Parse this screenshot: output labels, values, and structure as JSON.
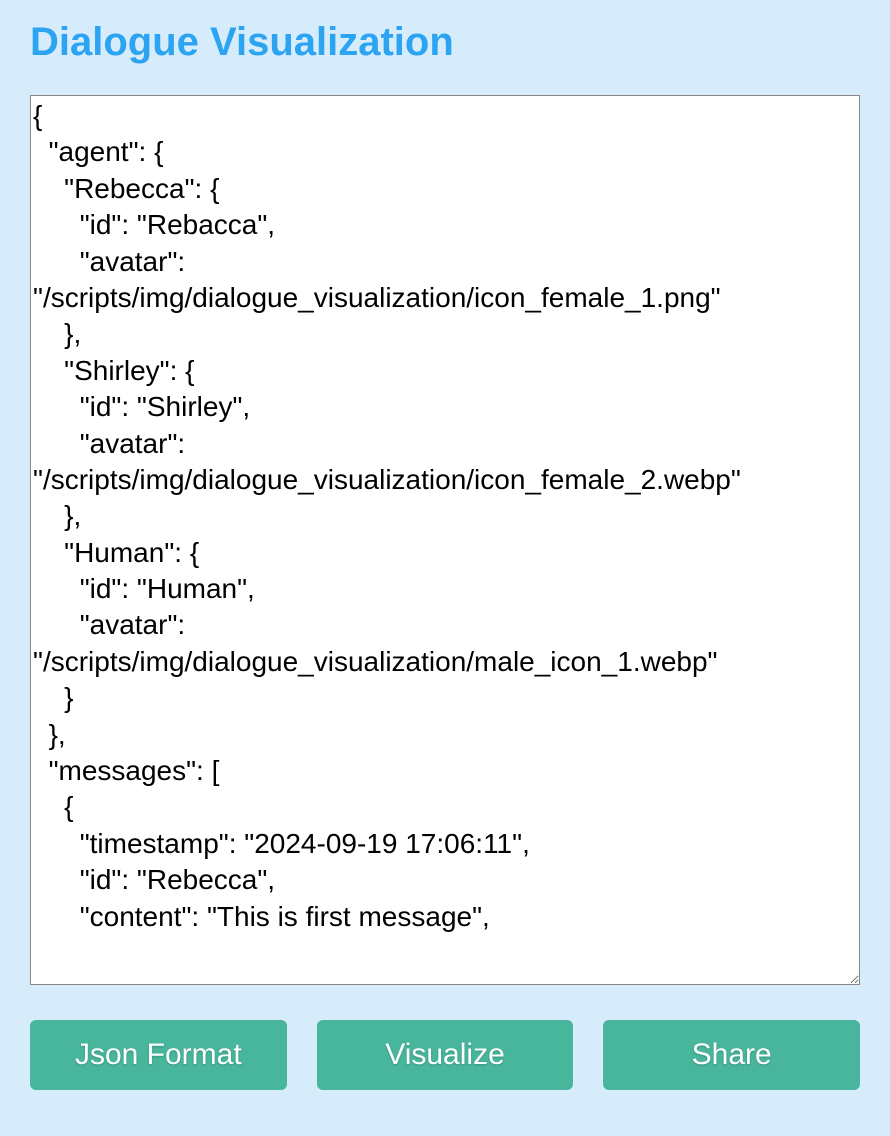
{
  "title": "Dialogue Visualization",
  "textarea_value": "{\n  \"agent\": {\n    \"Rebecca\": {\n      \"id\": \"Rebacca\",\n      \"avatar\": \"/scripts/img/dialogue_visualization/icon_female_1.png\"\n    },\n    \"Shirley\": {\n      \"id\": \"Shirley\",\n      \"avatar\": \"/scripts/img/dialogue_visualization/icon_female_2.webp\"\n    },\n    \"Human\": {\n      \"id\": \"Human\",\n      \"avatar\": \"/scripts/img/dialogue_visualization/male_icon_1.webp\"\n    }\n  },\n  \"messages\": [\n    {\n      \"timestamp\": \"2024-09-19 17:06:11\",\n      \"id\": \"Rebecca\",\n      \"content\": \"This is first message\",\n",
  "buttons": {
    "json_format": "Json Format",
    "visualize": "Visualize",
    "share": "Share"
  }
}
